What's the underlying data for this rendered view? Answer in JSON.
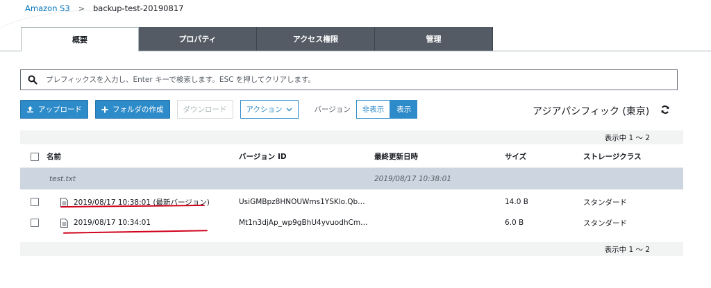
{
  "breadcrumb": {
    "root": "Amazon S3",
    "separator": ">",
    "current": "backup-test-20190817"
  },
  "tabs": [
    {
      "label": "概要",
      "active": true
    },
    {
      "label": "プロパティ",
      "active": false
    },
    {
      "label": "アクセス権限",
      "active": false
    },
    {
      "label": "管理",
      "active": false
    }
  ],
  "search": {
    "placeholder": "プレフィックスを入力し、Enter キーで検索します。ESC を押してクリアします。",
    "value": "",
    "icon": "search-icon"
  },
  "toolbar": {
    "upload": "アップロード",
    "create_folder": "フォルダの作成",
    "download": "ダウンロード",
    "actions": "アクション",
    "version_label": "バージョン",
    "hide": "非表示",
    "show": "表示",
    "show_selected": true
  },
  "region": "アジアパシフィック (東京)",
  "pager": {
    "text": "表示中 1 ～ 2"
  },
  "table": {
    "headers": {
      "name": "名前",
      "version_id": "バージョン ID",
      "last_modified": "最終更新日時",
      "size": "サイズ",
      "storage_class": "ストレージクラス"
    },
    "group": {
      "name": "test.txt",
      "last_modified": "2019/08/17 10:38:01"
    },
    "rows": [
      {
        "name": "2019/08/17 10:38:01 (最新バージョン)",
        "version_id": "UsiGMBpz8HNOUWms1YSKlo.Qb…",
        "size": "14.0 B",
        "storage_class": "スタンダード"
      },
      {
        "name": "2019/08/17 10:34:01",
        "version_id": "Mt1n3djAp_wp9gBhU4yvuodhCm…",
        "size": "6.0 B",
        "storage_class": "スタンダード"
      }
    ]
  },
  "colors": {
    "accent": "#2e8bc9",
    "tab_dark": "#545b64",
    "group_row": "#cdd6e0",
    "annotation": "#d0021b"
  }
}
